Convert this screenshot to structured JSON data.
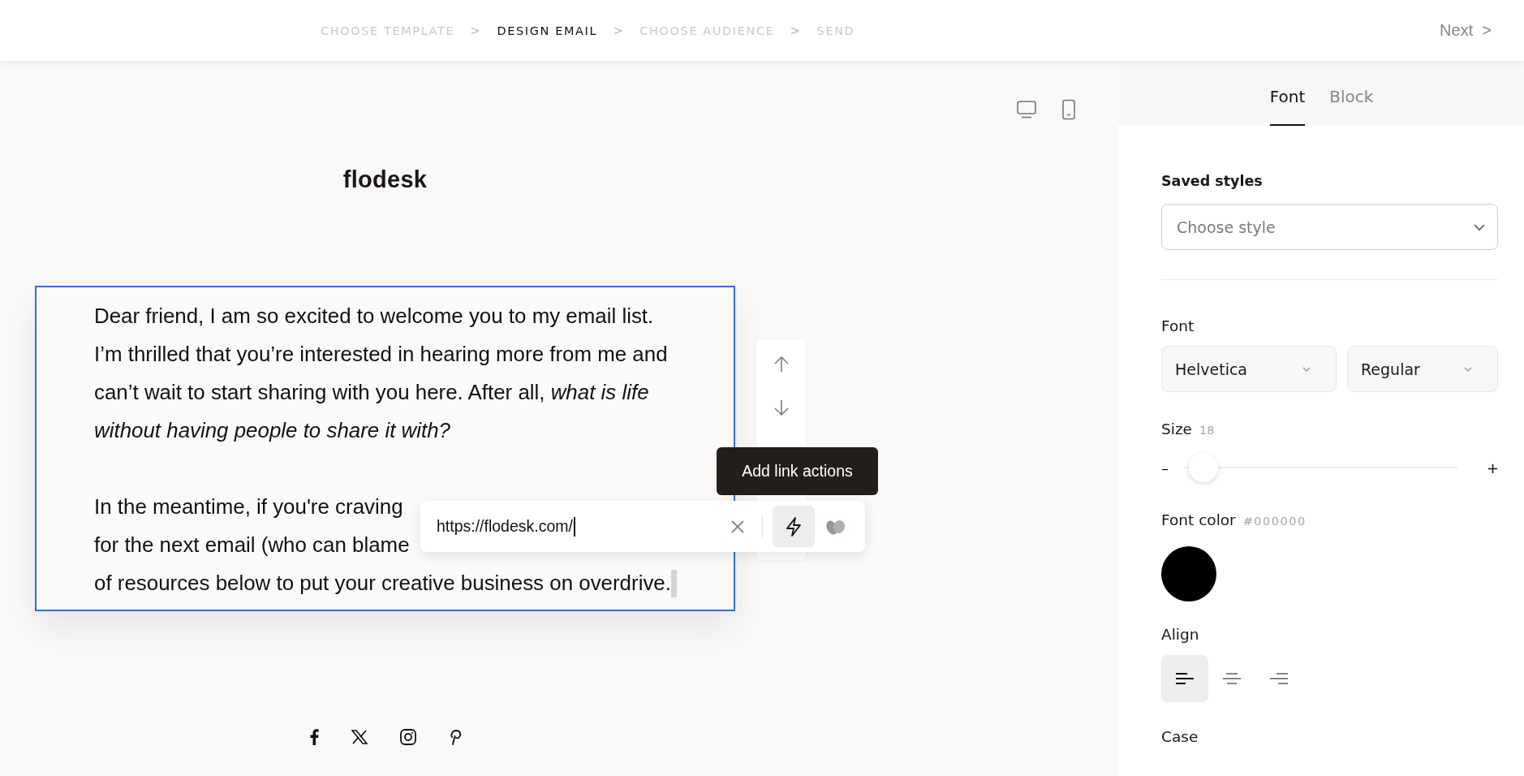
{
  "steps": [
    {
      "label": "CHOOSE TEMPLATE",
      "selected": false,
      "separator_after": ">"
    },
    {
      "label": "DESIGN EMAIL",
      "selected": true,
      "separator_after": ">"
    },
    {
      "label": "CHOOSE AUDIENCE",
      "selected": false,
      "separator_after": ">"
    },
    {
      "label": "SEND",
      "selected": false
    }
  ],
  "next_button": {
    "label": "Next",
    "icon": ">"
  },
  "preview_modes": [
    {
      "kind": "desktop"
    },
    {
      "kind": "mobile"
    }
  ],
  "email": {
    "logo": "flodesk",
    "block_selected": true,
    "paragraph": "Dear friend, I am so excited to welcome you to my email list. I’m thrilled that you’re interested in hearing more from me and can’t wait to start sharing with you here. After all, *what is life without having people to share it with?*",
    "cut_lines": [
      "In the meantime, if you're craving",
      "for the next email (who can blame",
      "of resources below to put your creative business on overdrive."
    ],
    "social_links": [
      {
        "kind": "facebook"
      },
      {
        "kind": "x"
      },
      {
        "kind": "instagram"
      },
      {
        "kind": "pinterest"
      }
    ]
  },
  "block_toolbar": [
    {
      "kind": "move_up"
    },
    {
      "kind": "move_down"
    }
  ],
  "link_popup": {
    "url": "https://flodesk.com/",
    "actions": [
      {
        "kind": "lightning",
        "selected": true
      },
      {
        "kind": "leaves",
        "selected": false
      }
    ]
  },
  "tooltip": "Add link actions",
  "panel": {
    "tabs": [
      {
        "label": "Font",
        "selected": true
      },
      {
        "label": "Block",
        "selected": false
      }
    ],
    "saved_styles": {
      "label": "Saved styles",
      "placeholder": "Choose style"
    },
    "font": {
      "label": "Font",
      "family": "Helvetica",
      "weight": "Regular"
    },
    "size": {
      "label": "Size",
      "value": "18",
      "level": 0.02,
      "minus": "–",
      "plus": "+"
    },
    "font_color": {
      "label": "Font color",
      "value": "#000000"
    },
    "align": {
      "label": "Align",
      "options": [
        {
          "kind": "left",
          "selected": true
        },
        {
          "kind": "center",
          "selected": false
        },
        {
          "kind": "right",
          "selected": false
        }
      ]
    },
    "case": {
      "label": "Case"
    }
  }
}
